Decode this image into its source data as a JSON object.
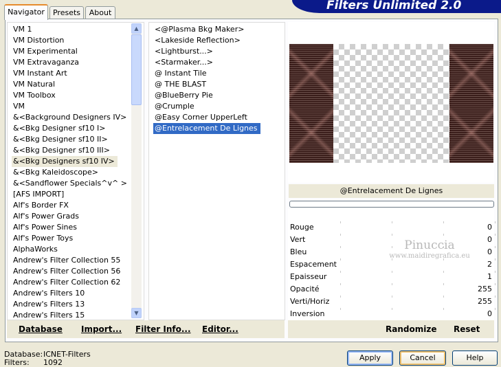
{
  "header": {
    "title": "Filters Unlimited 2.0"
  },
  "tabs": [
    {
      "label": "Navigator",
      "active": true
    },
    {
      "label": "Presets",
      "active": false
    },
    {
      "label": "About",
      "active": false
    }
  ],
  "categories": {
    "items": [
      "VM 1",
      "VM Distortion",
      "VM Experimental",
      "VM Extravaganza",
      "VM Instant Art",
      "VM Natural",
      "VM Toolbox",
      "VM",
      "&<Background Designers IV>",
      "&<Bkg Designer sf10 I>",
      "&<Bkg Designer sf10 II>",
      "&<Bkg Designer sf10 III>",
      "&<Bkg Designers sf10 IV>",
      "&<Bkg Kaleidoscope>",
      "&<Sandflower Specials^v^ >",
      "[AFS IMPORT]",
      "Alf's Border FX",
      "Alf's Power Grads",
      "Alf's Power Sines",
      "Alf's Power Toys",
      "AlphaWorks",
      "Andrew's Filter Collection 55",
      "Andrew's Filter Collection 56",
      "Andrew's Filter Collection 62",
      "Andrew's Filters 10",
      "Andrew's Filters 13",
      "Andrew's Filters 15"
    ],
    "selected_index": 12
  },
  "filters": {
    "items": [
      "<@Plasma Bkg Maker>",
      "<Lakeside Reflection>",
      "<Lightburst...>",
      "<Starmaker...>",
      "@ Instant Tile",
      "@ THE BLAST",
      "@BlueBerry Pie",
      "@Crumple",
      "@Easy Corner UpperLeft",
      "@Entrelacement De Lignes"
    ],
    "selected_index": 9
  },
  "left_buttons": {
    "database": "Database",
    "import": "Import...",
    "filter_info": "Filter Info...",
    "editor": "Editor..."
  },
  "selected_filter_name": "@Entrelacement De Lignes",
  "progress": 0,
  "params": [
    {
      "label": "Rouge",
      "value": "0"
    },
    {
      "label": "Vert",
      "value": "0"
    },
    {
      "label": "Bleu",
      "value": "0"
    },
    {
      "label": "Espacement",
      "value": "2"
    },
    {
      "label": "Epaisseur",
      "value": "1"
    },
    {
      "label": "Opacité",
      "value": "255"
    },
    {
      "label": "Verti/Horiz",
      "value": "255"
    },
    {
      "label": "Inversion",
      "value": "0"
    }
  ],
  "right_buttons": {
    "randomize": "Randomize",
    "reset": "Reset"
  },
  "watermark": {
    "name": "Pinuccia",
    "url": "www.maidiregrafica.eu"
  },
  "footer": {
    "database_label": "Database:",
    "database_value": "ICNET-Filters",
    "filters_label": "Filters:",
    "filters_value": "1092"
  },
  "dialog_buttons": {
    "apply": "Apply",
    "cancel": "Cancel",
    "help": "Help"
  },
  "colors": {
    "banner": "#0b1a8a",
    "selection": "#316ac5",
    "panel_bg": "#ece9d8",
    "preview_side": "#3a1d1a"
  }
}
